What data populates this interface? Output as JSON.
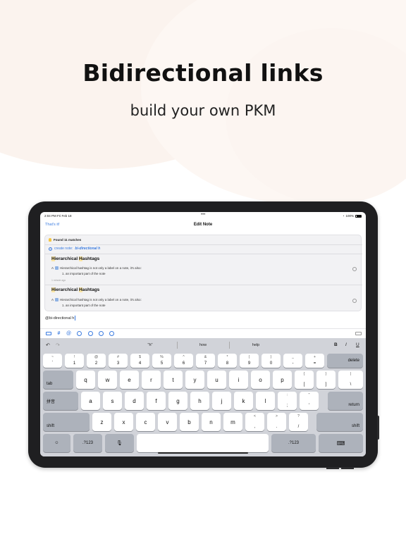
{
  "promo": {
    "headline": "Bidirectional links",
    "subline": "build your own PKM"
  },
  "status_bar": {
    "time_date": "2:04 PM  Fri Feb 18",
    "dots": "•••",
    "battery": "100%"
  },
  "nav": {
    "left": "That's it!",
    "title": "Edit Note"
  },
  "popup": {
    "found": "Found 11 matches",
    "create_prefix": "create note:",
    "create_note": "bi-directional h",
    "results": [
      {
        "title_hl1": "H",
        "title_rest1": "ierarchical ",
        "title_hl2": "H",
        "title_rest2": "ashtags",
        "line_a": "A",
        "line_text": "Hierarchical hashtag is not only a label on a note, it's also:",
        "item": "1.   an important part of the note",
        "ago": "1 minute ago"
      },
      {
        "title_hl1": "H",
        "title_rest1": "ierarchical ",
        "title_hl2": "H",
        "title_rest2": "ashtags",
        "line_a": "A",
        "line_text": "Hierarchical hashtag is not only a label on a note, it's also:",
        "item": "1.   an important part of the note"
      }
    ]
  },
  "editor": {
    "text": "@bi-directional h"
  },
  "toolbar": {
    "icons": [
      "image-icon",
      "hashtag-icon",
      "mention-icon",
      "pin-icon",
      "bell-off-icon",
      "play-icon",
      "link-icon"
    ],
    "hash": "#",
    "at": "@"
  },
  "keyboard": {
    "suggestions": [
      "\"h\"",
      "how",
      "help"
    ],
    "format": {
      "bold": "B",
      "italic": "I",
      "underline": "U"
    },
    "row1": [
      {
        "top": "~",
        "bot": "`"
      },
      {
        "top": "!",
        "bot": "1"
      },
      {
        "top": "@",
        "bot": "2"
      },
      {
        "top": "#",
        "bot": "3"
      },
      {
        "top": "$",
        "bot": "4"
      },
      {
        "top": "%",
        "bot": "5"
      },
      {
        "top": "^",
        "bot": "6"
      },
      {
        "top": "&",
        "bot": "7"
      },
      {
        "top": "*",
        "bot": "8"
      },
      {
        "top": "(",
        "bot": "9"
      },
      {
        "top": ")",
        "bot": "0"
      },
      {
        "top": "_",
        "bot": "-"
      },
      {
        "top": "+",
        "bot": "="
      }
    ],
    "delete": "delete",
    "tab": "tab",
    "row2": [
      "q",
      "w",
      "e",
      "r",
      "t",
      "y",
      "u",
      "i",
      "o",
      "p"
    ],
    "row2_punct": [
      {
        "top": "{",
        "bot": "["
      },
      {
        "top": "}",
        "bot": "]"
      },
      {
        "top": "|",
        "bot": "\\"
      }
    ],
    "lang": "拼音",
    "row3": [
      "a",
      "s",
      "d",
      "f",
      "g",
      "h",
      "j",
      "k",
      "l"
    ],
    "row3_punct": [
      {
        "top": ":",
        "bot": ";"
      },
      {
        "top": "\"",
        "bot": "'"
      }
    ],
    "return": "return",
    "shift": "shift",
    "row4": [
      "z",
      "x",
      "c",
      "v",
      "b",
      "n",
      "m"
    ],
    "row4_punct": [
      {
        "top": "<",
        "bot": ","
      },
      {
        "top": ">",
        "bot": "."
      },
      {
        "top": "?",
        "bot": "/"
      }
    ],
    "num_left": ".?123",
    "num_right": ".?123",
    "emoji": "☺",
    "mic": "🎙",
    "kbd": "⌨"
  }
}
